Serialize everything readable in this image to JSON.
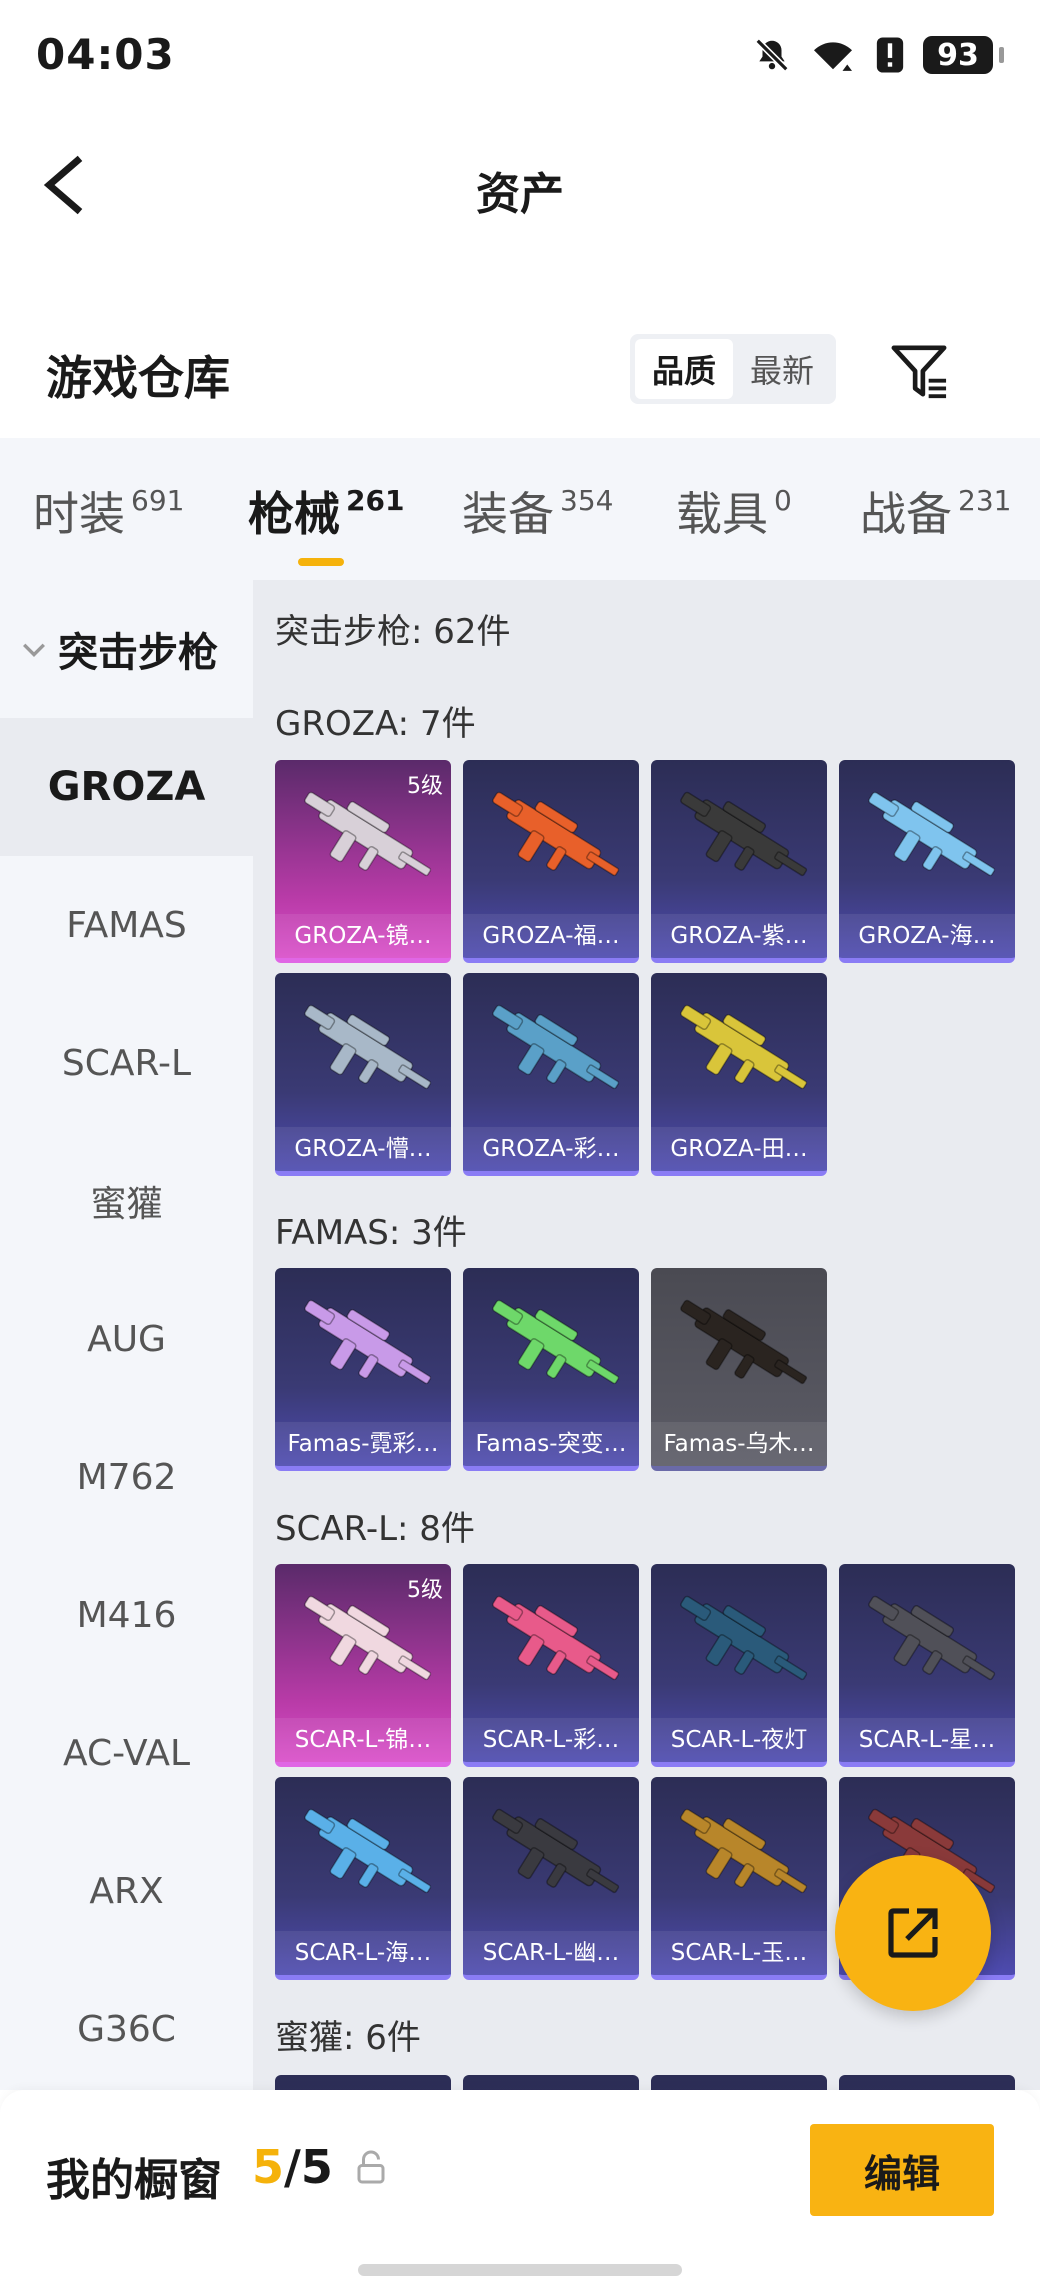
{
  "status_bar": {
    "time": "04:03",
    "battery": "93"
  },
  "header": {
    "title": "资产"
  },
  "warehouse": {
    "title": "游戏仓库",
    "sort_options": [
      "品质",
      "最新"
    ]
  },
  "category_tabs": [
    {
      "label": "时装",
      "count": "691"
    },
    {
      "label": "枪械",
      "count": "261"
    },
    {
      "label": "装备",
      "count": "354"
    },
    {
      "label": "载具",
      "count": "0"
    },
    {
      "label": "战备",
      "count": "231"
    }
  ],
  "sidebar": {
    "group": "突击步枪",
    "items": [
      "GROZA",
      "FAMAS",
      "SCAR-L",
      "蜜獾",
      "AUG",
      "M762",
      "M416",
      "AC-VAL",
      "ARX",
      "G36C"
    ]
  },
  "main": {
    "summary": "突击步枪: 62件",
    "sections": [
      {
        "header": "GROZA: 7件",
        "items": [
          {
            "name": "GROZA-镜…",
            "level": "5级",
            "style": "pink",
            "color": "#d8d0d8"
          },
          {
            "name": "GROZA-福…",
            "level": "",
            "style": "purple",
            "color": "#e8602a"
          },
          {
            "name": "GROZA-紫…",
            "level": "",
            "style": "purple",
            "color": "#3a3a3a"
          },
          {
            "name": "GROZA-海…",
            "level": "",
            "style": "purple",
            "color": "#7fc4ee"
          },
          {
            "name": "GROZA-懵…",
            "level": "",
            "style": "purple",
            "color": "#a8b8c8"
          },
          {
            "name": "GROZA-彩…",
            "level": "",
            "style": "purple",
            "color": "#5aa0c8"
          },
          {
            "name": "GROZA-田…",
            "level": "",
            "style": "purple",
            "color": "#d9c53a"
          }
        ]
      },
      {
        "header": "FAMAS: 3件",
        "items": [
          {
            "name": "Famas-霓彩…",
            "level": "",
            "style": "purple",
            "color": "#c89ae8"
          },
          {
            "name": "Famas-突变…",
            "level": "",
            "style": "purple",
            "color": "#6ed86a"
          },
          {
            "name": "Famas-乌木…",
            "level": "",
            "style": "gray",
            "color": "#2a2420"
          }
        ]
      },
      {
        "header": "SCAR-L: 8件",
        "items": [
          {
            "name": "SCAR-L-锦…",
            "level": "5级",
            "style": "pink",
            "color": "#f0d8e0"
          },
          {
            "name": "SCAR-L-彩…",
            "level": "",
            "style": "purple",
            "color": "#e85a8a"
          },
          {
            "name": "SCAR-L-夜灯",
            "level": "",
            "style": "purple",
            "color": "#2a5a7a"
          },
          {
            "name": "SCAR-L-星…",
            "level": "",
            "style": "purple",
            "color": "#505058"
          },
          {
            "name": "SCAR-L-海…",
            "level": "",
            "style": "purple",
            "color": "#5ab0e8"
          },
          {
            "name": "SCAR-L-幽…",
            "level": "",
            "style": "purple",
            "color": "#3a3a40"
          },
          {
            "name": "SCAR-L-玉…",
            "level": "",
            "style": "purple",
            "color": "#b8862a"
          },
          {
            "name": "",
            "level": "",
            "style": "purple",
            "color": "#8a3a3a"
          }
        ]
      },
      {
        "header": "蜜獾: 6件",
        "items": [
          {
            "name": "",
            "level": "",
            "style": "purple",
            "color": "#3a3a74"
          },
          {
            "name": "",
            "level": "",
            "style": "purple",
            "color": "#3a3a74"
          },
          {
            "name": "",
            "level": "",
            "style": "purple",
            "color": "#3a3a74"
          },
          {
            "name": "",
            "level": "",
            "style": "purple",
            "color": "#3a3a74"
          }
        ]
      }
    ]
  },
  "bottom_bar": {
    "title": "我的橱窗",
    "count_current": "5",
    "count_total": "5",
    "edit_label": "编辑"
  },
  "colors": {
    "accent": "#f9b312",
    "rare_pink": "#d94fc9",
    "card_purple": "#3a3a74"
  }
}
